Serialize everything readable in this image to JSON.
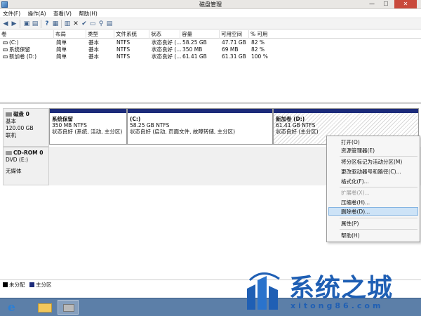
{
  "window": {
    "title": "磁盘管理",
    "controls": {
      "minimize": "—",
      "maximize": "☐",
      "close": "✕"
    }
  },
  "menu": [
    "文件(F)",
    "操作(A)",
    "查看(V)",
    "帮助(H)"
  ],
  "volume_list": {
    "columns": [
      "卷",
      "布局",
      "类型",
      "文件系统",
      "状态",
      "容量",
      "可用空间",
      "% 可用"
    ],
    "rows": [
      [
        "(C:)",
        "简单",
        "基本",
        "NTFS",
        "状态良好 (...",
        "58.25 GB",
        "47.71 GB",
        "82 %"
      ],
      [
        "系统保留",
        "简单",
        "基本",
        "NTFS",
        "状态良好 (...",
        "350 MB",
        "69 MB",
        "82 %"
      ],
      [
        "新加卷 (D:)",
        "简单",
        "基本",
        "NTFS",
        "状态良好 (...",
        "61.41 GB",
        "61.31 GB",
        "100 %"
      ]
    ]
  },
  "disks": {
    "disk0": {
      "name": "磁盘 0",
      "type": "基本",
      "size": "120.00 GB",
      "status": "联机",
      "partitions": [
        {
          "name": "系统保留",
          "size": "350 MB NTFS",
          "status": "状态良好 (系统, 活动, 主分区)"
        },
        {
          "name": "(C:)",
          "size": "58.25 GB NTFS",
          "status": "状态良好 (启动, 页面文件, 故障转储, 主分区)"
        },
        {
          "name": "新加卷  (D:)",
          "size": "61.41 GB NTFS",
          "status": "状态良好 (主分区)"
        }
      ]
    },
    "cdrom0": {
      "name": "CD-ROM 0",
      "drive": "DVD (E:)",
      "status": "无媒体"
    }
  },
  "context_menu": {
    "items": [
      {
        "label": "打开(O)",
        "disabled": false
      },
      {
        "label": "资源管理器(E)",
        "disabled": false
      },
      {
        "label": "将分区标记为活动分区(M)",
        "disabled": false
      },
      {
        "label": "更改驱动器号和路径(C)...",
        "disabled": false
      },
      {
        "label": "格式化(F)...",
        "disabled": false
      },
      {
        "label": "扩展卷(X)...",
        "disabled": true
      },
      {
        "label": "压缩卷(H)...",
        "disabled": false
      },
      {
        "label": "删除卷(D)...",
        "disabled": false,
        "highlighted": true
      },
      {
        "label": "属性(P)",
        "disabled": false
      },
      {
        "label": "帮助(H)",
        "disabled": false
      }
    ]
  },
  "legend": [
    {
      "label": "未分配",
      "color": "#000000"
    },
    {
      "label": "主分区",
      "color": "#1c2b7a"
    }
  ],
  "watermark": {
    "title": "系统之城",
    "url": "xitong86.com"
  },
  "colors": {
    "partition_bar": "#1c2b7a",
    "taskbar": "#5c7fa8",
    "watermark": "#1f5fb4",
    "highlight": "#cde3f7"
  }
}
